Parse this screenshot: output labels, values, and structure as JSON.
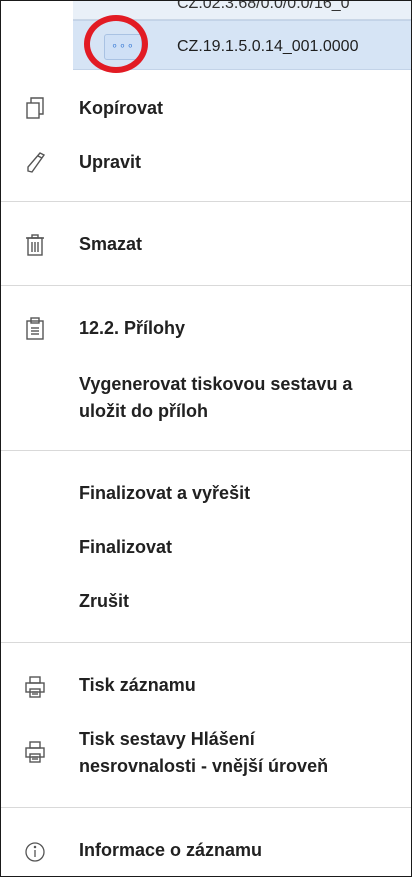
{
  "table": {
    "previous_row_text": "CZ.02.3.68/0.0/0.0/16_0",
    "selected_row_code": "CZ.19.1.5.0.14_001.0000",
    "more_button_label": "∘∘∘"
  },
  "menu": {
    "copy": {
      "label": "Kopírovat",
      "icon": "copy-icon"
    },
    "edit": {
      "label": "Upravit",
      "icon": "pencil-icon"
    },
    "delete": {
      "label": "Smazat",
      "icon": "trash-icon"
    },
    "attachments": {
      "label": "12.2. Přílohy",
      "icon": "clipboard-icon"
    },
    "generate_report": {
      "label": "Vygenerovat tiskovou sestavu a\nuložit do příloh"
    },
    "finalize_resolve": {
      "label": "Finalizovat a vyřešit"
    },
    "finalize": {
      "label": "Finalizovat"
    },
    "cancel": {
      "label": "Zrušit"
    },
    "print_record": {
      "label": "Tisk záznamu",
      "icon": "printer-icon"
    },
    "print_report": {
      "label": "Tisk sestavy Hlášení\nnesrovnalosti - vnější úroveň",
      "icon": "printer-icon"
    },
    "record_info": {
      "label": "Informace o záznamu",
      "icon": "info-icon"
    }
  },
  "colors": {
    "highlight_ring": "#e21b24",
    "selected_row": "#d6e4f5",
    "text": "#212121",
    "icon": "#555555"
  }
}
